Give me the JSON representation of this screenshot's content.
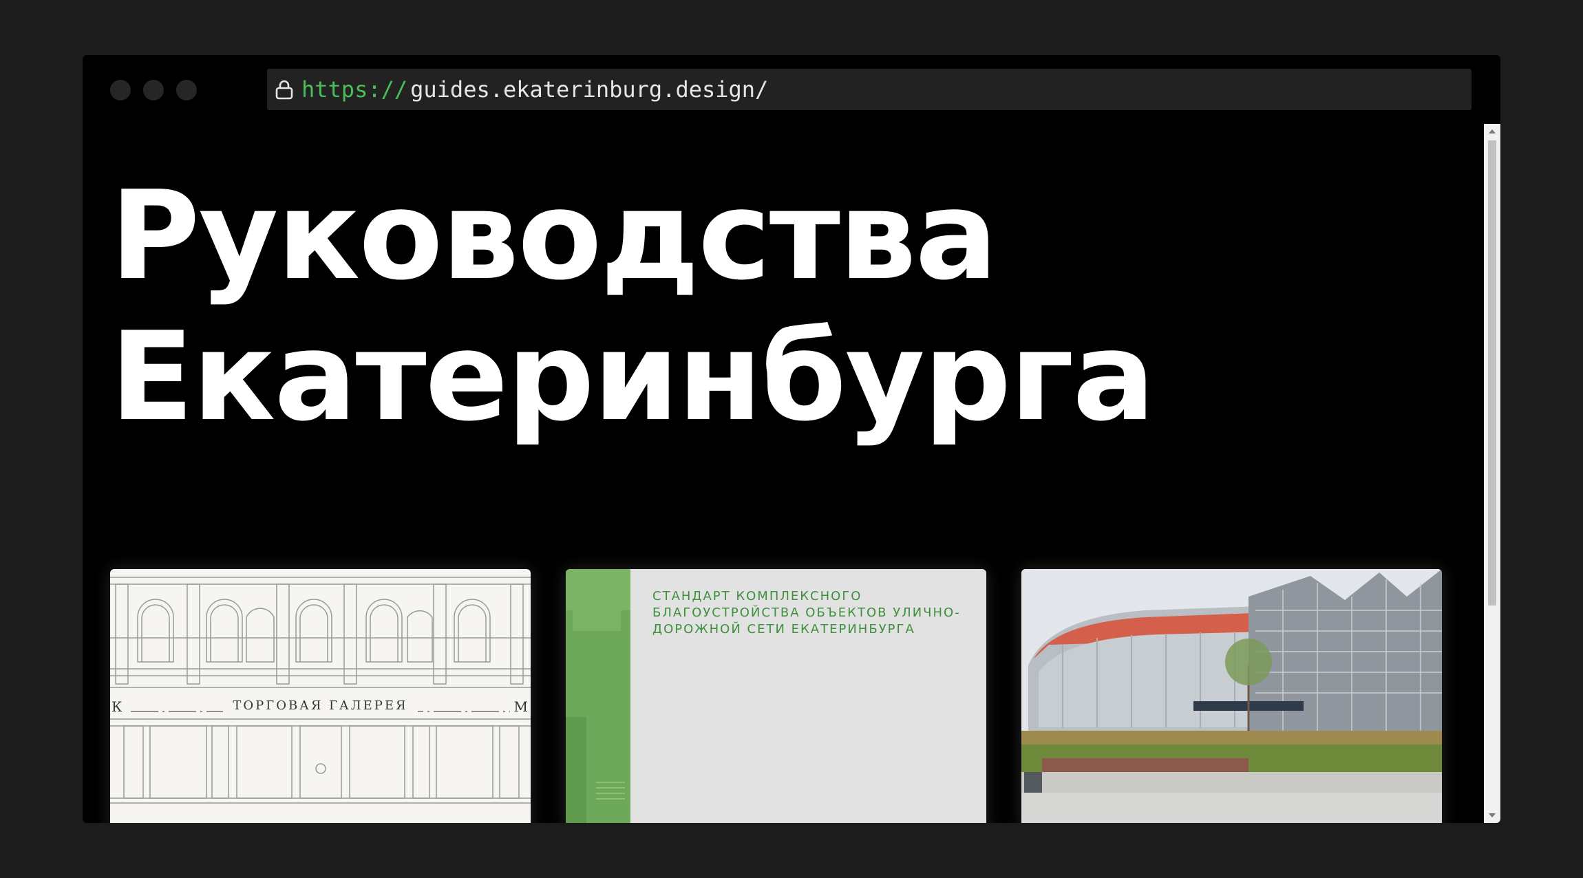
{
  "browser": {
    "url_scheme": "https://",
    "url_host": "guides.ekaterinburg.design/",
    "window_controls": [
      "close-dot",
      "minimize-dot",
      "maximize-dot"
    ]
  },
  "page": {
    "heading_line1": "Руководства",
    "heading_line2": "Екатеринбурга"
  },
  "cards": [
    {
      "kind": "facade-illustration",
      "sign_text": "ТОРГОВАЯ ГАЛЕРЕЯ",
      "edge_left": "К",
      "edge_right": "М"
    },
    {
      "kind": "document-cover",
      "title": "СТАНДАРТ КОМПЛЕКСНОГО БЛАГОУСТРОЙСТВА ОБЪЕКТОВ УЛИЧНО-ДОРОЖНОЙ СЕТИ ЕКАТЕРИНБУРГА",
      "title_color": "#3f8f3c"
    },
    {
      "kind": "stadium-photo"
    }
  ],
  "colors": {
    "page_bg": "#1c1c1c",
    "window_bg": "#000000",
    "url_scheme": "#4bbd5a",
    "accent_green": "#6ea85a"
  }
}
